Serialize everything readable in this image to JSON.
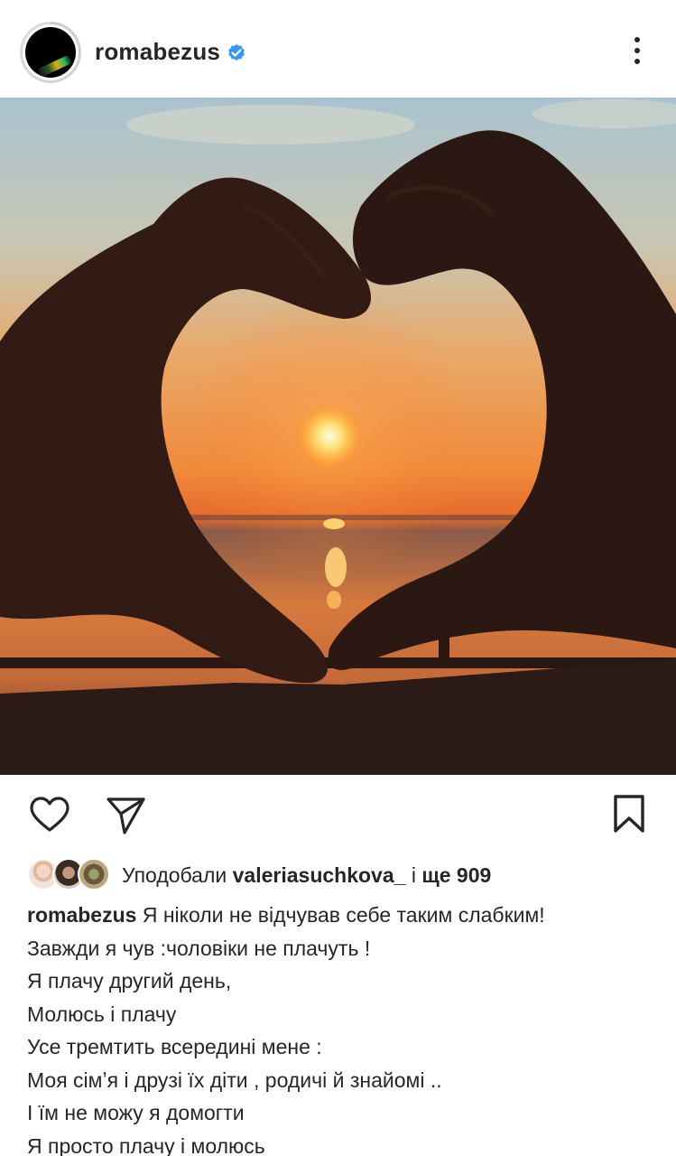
{
  "post": {
    "author": {
      "username": "romabezus",
      "verified": true,
      "avatar_icon": "avatar-image"
    },
    "more_icon": "more-vertical-icon",
    "photo": {
      "description_icon": "post-photo"
    },
    "actions": {
      "like_icon": "heart-icon",
      "share_icon": "send-icon",
      "save_icon": "bookmark-icon"
    },
    "likes": {
      "prefix": "Уподобали",
      "liker": "valeriasuchkova_",
      "connector": "і",
      "others": "ще 909"
    },
    "caption": {
      "username": "romabezus",
      "lines": [
        "Я ніколи не відчував себе таким слабким!",
        "Завжди я чув :чоловіки не плачуть !",
        "Я плачу другий день,",
        "Молюсь і плачу",
        "Усе тремтить всередині мене :",
        "Моя сімʼя і друзі їх діти , родичі й знайомі ..",
        "І їм не можу я домогти",
        "Я просто плачу і молюсь"
      ]
    }
  },
  "colors": {
    "text": "#262626",
    "verified": "#3897f0",
    "background": "#ffffff"
  }
}
